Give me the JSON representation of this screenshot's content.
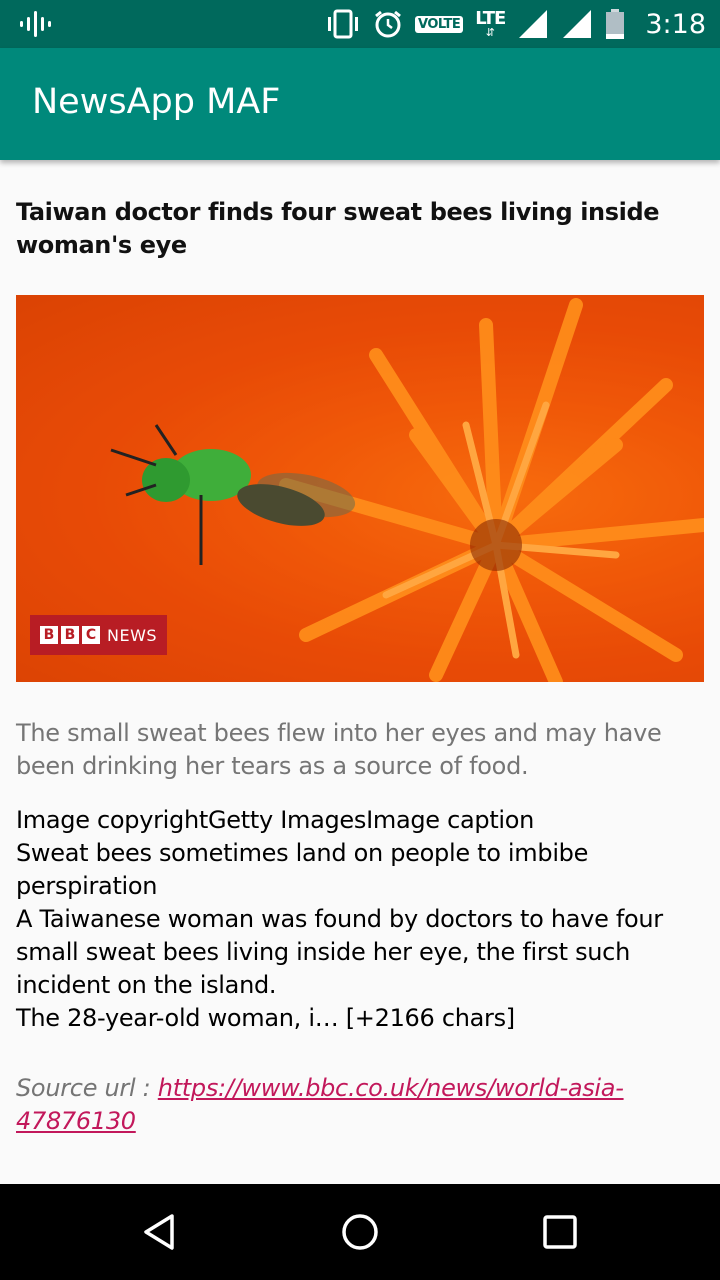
{
  "status_bar": {
    "volte_label": "VOLTE",
    "network_label": "LTE",
    "network_arrows": "⇵",
    "time": "3:18",
    "icons": [
      "podcast-icon",
      "vibrate-icon",
      "alarm-icon",
      "signal-icon",
      "signal-icon",
      "battery-icon"
    ]
  },
  "app_bar": {
    "title": "NewsApp MAF"
  },
  "article": {
    "title": "Taiwan doctor finds four sweat bees living inside woman's eye",
    "image_badge": {
      "letters": [
        "B",
        "B",
        "C"
      ],
      "label": "NEWS"
    },
    "description": "The small sweat bees flew into her eyes and may have been drinking her tears as a source of food.",
    "body": "Image copyrightGetty ImagesImage caption\n Sweat bees sometimes land on people to imbibe perspiration\nA Taiwanese woman was found by doctors to have four small sweat bees living inside her eye, the first such incident on the island.\nThe 28-year-old woman, i… [+2166 chars]",
    "source_label": "Source url : ",
    "source_url": "https://www.bbc.co.uk/news/world-asia-47876130"
  },
  "colors": {
    "status_bar": "#00695c",
    "app_bar": "#00897b",
    "link": "#c2185b",
    "description": "#757575"
  }
}
